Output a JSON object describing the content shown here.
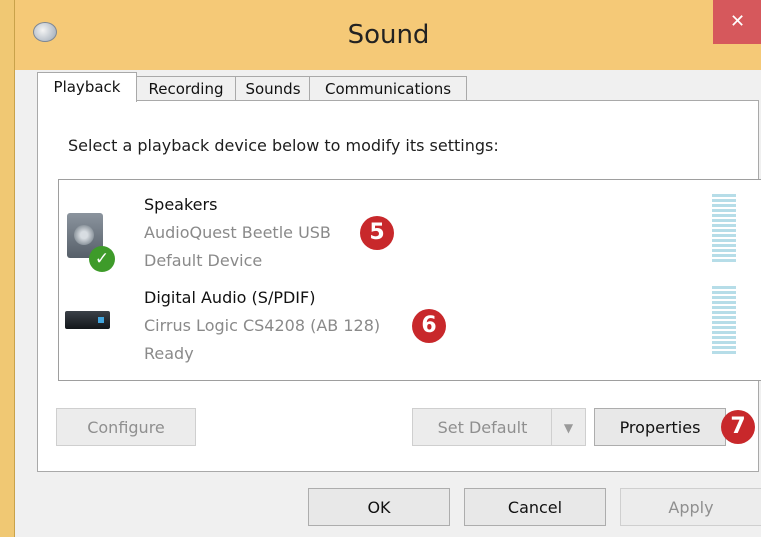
{
  "window": {
    "title": "Sound",
    "close_glyph": "✕"
  },
  "tabs": [
    {
      "label": "Playback",
      "active": true
    },
    {
      "label": "Recording",
      "active": false
    },
    {
      "label": "Sounds",
      "active": false
    },
    {
      "label": "Communications",
      "active": false
    }
  ],
  "playback": {
    "instruction": "Select a playback device below to modify its settings:",
    "devices": [
      {
        "name": "Speakers",
        "model": "AudioQuest Beetle USB",
        "status": "Default Device",
        "icon": "speaker-icon",
        "is_default": true,
        "callout": "5"
      },
      {
        "name": "Digital Audio (S/PDIF)",
        "model": "Cirrus Logic CS4208 (AB 128)",
        "status": "Ready",
        "icon": "spdif-device-icon",
        "is_default": false,
        "callout": "6"
      }
    ],
    "buttons": {
      "configure": "Configure",
      "set_default": "Set Default",
      "properties": "Properties",
      "properties_callout": "7"
    }
  },
  "footer": {
    "ok": "OK",
    "cancel": "Cancel",
    "apply": "Apply"
  },
  "colors": {
    "title_bar": "#f5c977",
    "close": "#d6585c",
    "callout": "#c8282b",
    "default_check": "#3e9b2a"
  }
}
